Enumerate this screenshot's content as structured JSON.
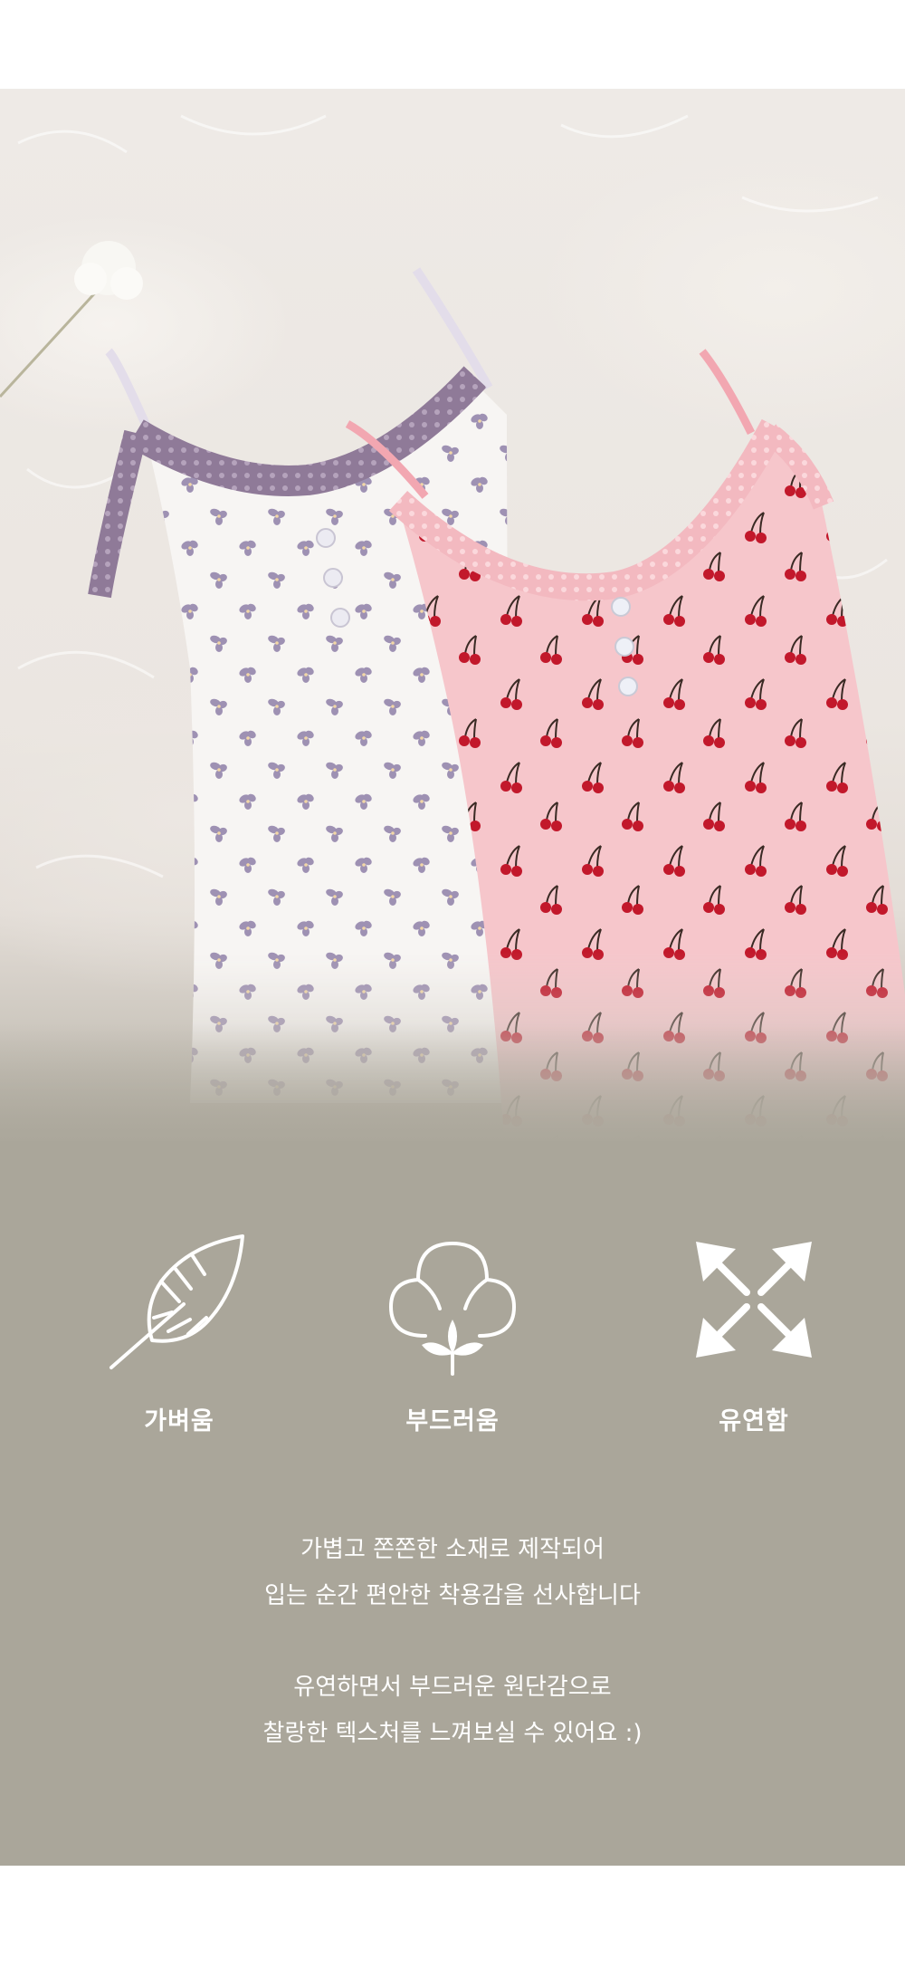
{
  "features": [
    {
      "icon": "feather-icon",
      "label": "가벼움"
    },
    {
      "icon": "cotton-flower-icon",
      "label": "부드러움"
    },
    {
      "icon": "stretch-arrows-icon",
      "label": "유연함"
    }
  ],
  "description": {
    "paragraph1": [
      "가볍고 쫀쫀한 소재로 제작되어",
      "입는 순간 편안한 착용감을 선사합니다"
    ],
    "paragraph2": [
      "유연하면서 부드러운 원단감으로",
      "찰랑한 텍스처를 느껴보실 수 있어요 :)"
    ]
  },
  "colors": {
    "panel": "#aaa69a",
    "text": "#ffffff",
    "dress_white": "#f7f5f3",
    "dress_pink": "#f6c6cb",
    "lace_purple": "#8f7a98",
    "lace_pink": "#f3b9c0",
    "cherry": "#c2182b"
  }
}
